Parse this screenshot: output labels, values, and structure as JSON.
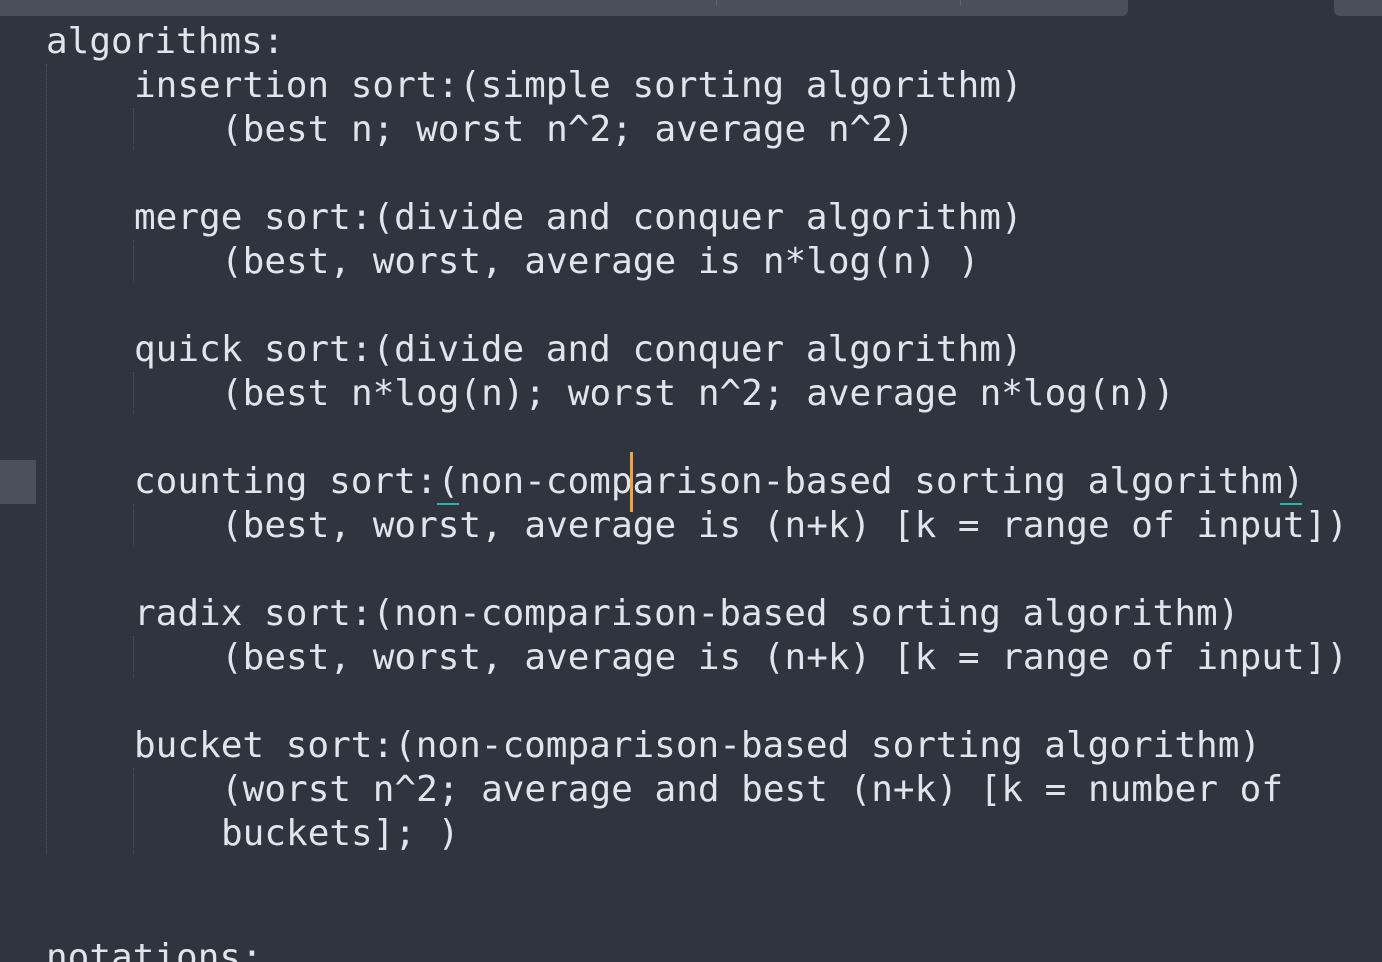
{
  "document": {
    "heading": "algorithms:",
    "sections": [
      {
        "title": "insertion sort:(simple sorting algorithm)",
        "details": [
          "(best n; worst n^2; average n^2)"
        ]
      },
      {
        "title": "merge sort:(divide and conquer algorithm)",
        "details": [
          "(best, worst, average is n*log(n) )"
        ]
      },
      {
        "title": "quick sort:(divide and conquer algorithm)",
        "details": [
          "(best n*log(n); worst n^2; average n*log(n))"
        ]
      },
      {
        "title": "counting sort:(non-comparison-based sorting algorithm)",
        "details": [
          "(best, worst, average is (n+k) [k = range of input])"
        ]
      },
      {
        "title": "radix sort:(non-comparison-based sorting algorithm)",
        "details": [
          "(best, worst, average is (n+k) [k = range of input])"
        ]
      },
      {
        "title": "bucket sort:(non-comparison-based sorting algorithm)",
        "details": [
          "(worst n^2; average and best (n+k) [k = number of",
          "buckets]; )"
        ]
      }
    ],
    "next_heading": "notations:"
  },
  "colors": {
    "background": "#2f343f",
    "text": "#e1e4ea",
    "cursor": "#f0a24a",
    "bracket_match": "#2fb3a9",
    "gutter_highlight": "#4a515c"
  }
}
